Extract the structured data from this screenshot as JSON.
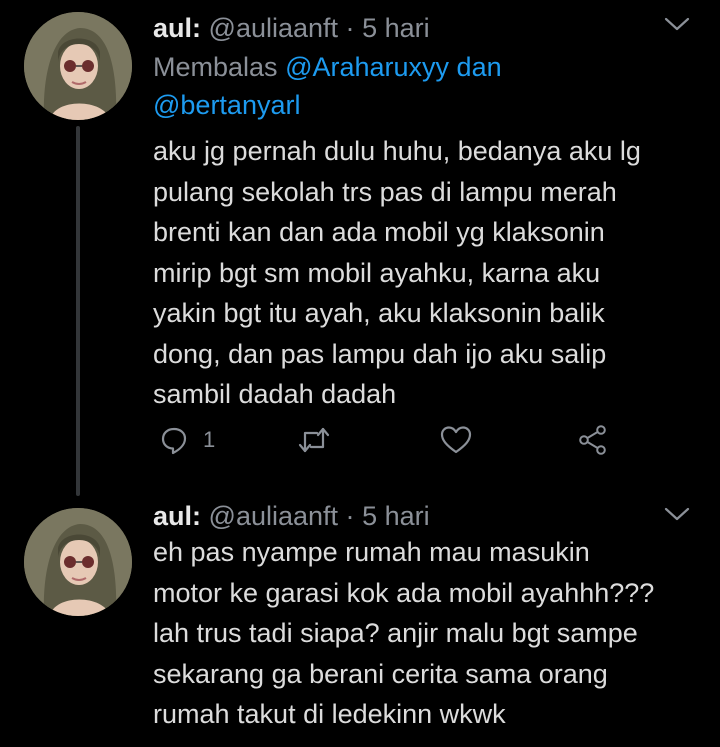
{
  "tweets": [
    {
      "display_name": "aul:",
      "handle": "@auliaanft",
      "separator": "·",
      "time": "5 hari",
      "replying_prefix": "Membalas",
      "replying_mention_1": "@Araharuxyy",
      "replying_conj": "dan",
      "replying_mention_2": "@bertanyarl",
      "text": "aku jg pernah dulu huhu, bedanya aku lg\npulang sekolah trs pas di lampu merah\nbrenti kan dan ada mobil yg klaksonin\nmirip bgt sm mobil ayahku, karna aku\nyakin bgt itu ayah, aku klaksonin balik\ndong, dan pas lampu dah ijo aku salip\nsambil dadah dadah",
      "reply_count": "1",
      "icons": [
        "chevron-down-icon",
        "reply-icon",
        "retweet-icon",
        "like-icon",
        "share-icon"
      ]
    },
    {
      "display_name": "aul:",
      "handle": "@auliaanft",
      "separator": "·",
      "time": "5 hari",
      "text": "eh pas nyampe rumah mau masukin\nmotor ke garasi kok ada mobil ayahhh???\nlah trus tadi siapa? anjir malu bgt sampe\nsekarang ga berani cerita sama orang\nrumah takut di ledekinn wkwk",
      "icons": [
        "chevron-down-icon"
      ]
    }
  ],
  "colors": {
    "background": "#000000",
    "text": "#dcdcdc",
    "secondary": "#8b9098",
    "mention": "#1d9bf0",
    "thread_line": "#333639"
  }
}
